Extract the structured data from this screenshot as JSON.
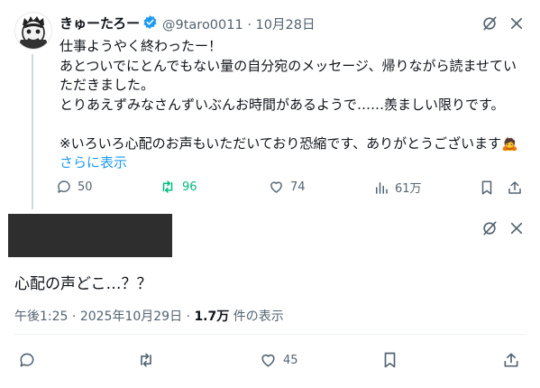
{
  "tweet": {
    "author": {
      "display_name": "きゅーたろー",
      "handle": "@9taro0011",
      "separator": "·",
      "date": "10月28日"
    },
    "lines": [
      "仕事ようやく終わったー！",
      "あとついでにとんでもない量の自分宛のメッセージ、帰りながら読ませてい",
      "ただきました。",
      "とりあえずみなさんずいぶんお時間があるようで……羨ましい限りです。",
      "",
      "※いろいろ心配のお声もいただいており恐縮です、ありがとうございます"
    ],
    "emoji": "🙇",
    "show_more": "さらに表示",
    "actions": {
      "replies": "50",
      "reposts": "96",
      "likes": "74",
      "views": "61万"
    },
    "colors": {
      "repost_active": "#00ba7c",
      "link": "#1d9bf0",
      "verified": "#1d9bf0"
    }
  },
  "reply": {
    "text": "心配の声どこ…？？",
    "time": "午後1:25",
    "separator": "·",
    "date": "2025年10月29日",
    "dot": "·",
    "views_count": "1.7万",
    "views_label": "件の表示",
    "actions": {
      "likes": "45"
    }
  },
  "icons": [
    "grok-icon",
    "more-icon",
    "reply-icon",
    "repost-icon",
    "like-icon",
    "views-icon",
    "bookmark-icon",
    "share-icon",
    "verified-badge-icon"
  ]
}
